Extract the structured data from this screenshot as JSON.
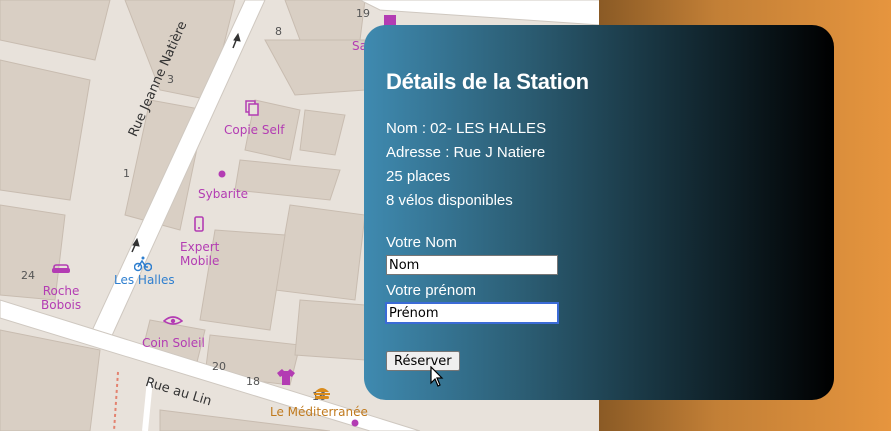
{
  "map": {
    "streets": [
      "Rue Jeanne Natière",
      "Rue au Lin"
    ],
    "pois": [
      {
        "label": "Copie Self",
        "icon": "copy-shop-icon"
      },
      {
        "label": "Sybarite",
        "icon": "dot-icon"
      },
      {
        "label": "Expert\nMobile",
        "icon": "mobile-phone-icon"
      },
      {
        "label": "Les Halles",
        "icon": "bicycle-station-icon"
      },
      {
        "label": "Roche\nBobois",
        "icon": "sofa-icon"
      },
      {
        "label": "Coin Soleil",
        "icon": "eye-makeup-icon"
      },
      {
        "label": "Le Méditerranée",
        "icon": "burger-icon"
      },
      {
        "label": "Sa",
        "icon": "shop-icon"
      }
    ],
    "house_numbers": [
      "19",
      "8",
      "3",
      "1",
      "24",
      "20",
      "18",
      "16"
    ]
  },
  "panel": {
    "title": "Détails de la Station",
    "name_line": "Nom : 02- LES HALLES",
    "address_line": "Adresse : Rue J Natiere",
    "places_line": "25 places",
    "bikes_line": "8 vélos disponibles"
  },
  "form": {
    "nom_label": "Votre Nom",
    "nom_value": "Nom",
    "prenom_label": "Votre prénom",
    "prenom_value": "Prénom",
    "submit_label": "Réserver"
  },
  "colors": {
    "panel_gradient_start": "#3f8ab0",
    "panel_gradient_end": "#000000",
    "side_background": "#e6953e",
    "poi_color": "#b33cb3",
    "station_color": "#2f7fcf"
  }
}
